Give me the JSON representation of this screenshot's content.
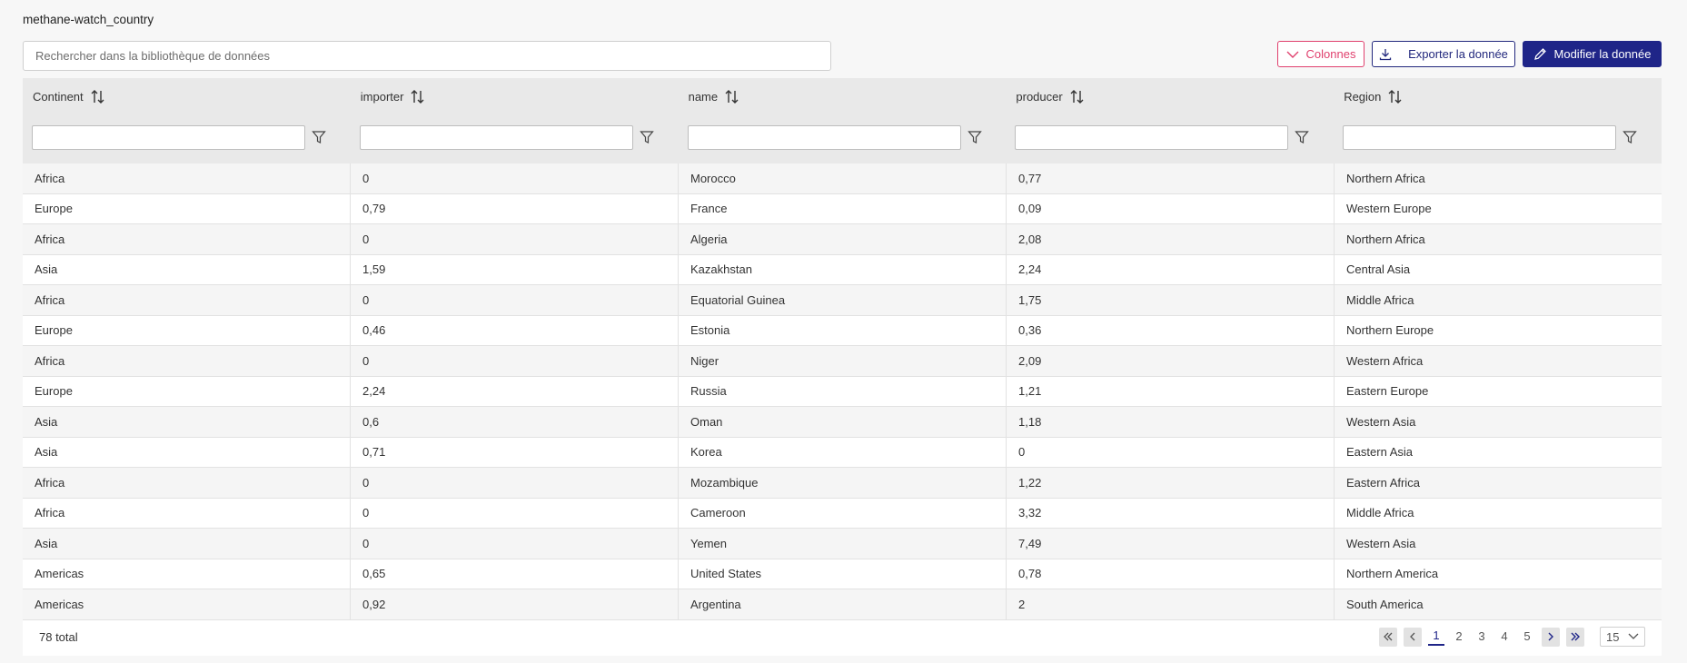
{
  "page": {
    "title": "methane-watch_country"
  },
  "search": {
    "placeholder": "Rechercher dans la bibliothèque de données"
  },
  "toolbar": {
    "columns_label": "Colonnes",
    "export_label": "Exporter la donnée",
    "edit_label": "Modifier la donnée"
  },
  "table": {
    "columns": [
      "Continent",
      "importer",
      "name",
      "producer",
      "Region"
    ],
    "rows": [
      [
        "Africa",
        "0",
        "Morocco",
        "0,77",
        "Northern Africa"
      ],
      [
        "Europe",
        "0,79",
        "France",
        "0,09",
        "Western Europe"
      ],
      [
        "Africa",
        "0",
        "Algeria",
        "2,08",
        "Northern Africa"
      ],
      [
        "Asia",
        "1,59",
        "Kazakhstan",
        "2,24",
        "Central Asia"
      ],
      [
        "Africa",
        "0",
        "Equatorial Guinea",
        "1,75",
        "Middle Africa"
      ],
      [
        "Europe",
        "0,46",
        "Estonia",
        "0,36",
        "Northern Europe"
      ],
      [
        "Africa",
        "0",
        "Niger",
        "2,09",
        "Western Africa"
      ],
      [
        "Europe",
        "2,24",
        "Russia",
        "1,21",
        "Eastern Europe"
      ],
      [
        "Asia",
        "0,6",
        "Oman",
        "1,18",
        "Western Asia"
      ],
      [
        "Asia",
        "0,71",
        "Korea",
        "0",
        "Eastern Asia"
      ],
      [
        "Africa",
        "0",
        "Mozambique",
        "1,22",
        "Eastern Africa"
      ],
      [
        "Africa",
        "0",
        "Cameroon",
        "3,32",
        "Middle Africa"
      ],
      [
        "Asia",
        "0",
        "Yemen",
        "7,49",
        "Western Asia"
      ],
      [
        "Americas",
        "0,65",
        "United States",
        "0,78",
        "Northern America"
      ],
      [
        "Americas",
        "0,92",
        "Argentina",
        "2",
        "South America"
      ]
    ]
  },
  "footer": {
    "total_label": "78 total",
    "pages": [
      "1",
      "2",
      "3",
      "4",
      "5"
    ],
    "current_page": "1",
    "page_size": "15"
  },
  "colors": {
    "primary": "#1f2588",
    "columns_button": "#e0416e",
    "header_bg": "#e9e9e9"
  },
  "icons": {
    "columns_button": "chevron-down-icon",
    "export_button": "download-icon",
    "edit_button": "pencil-icon",
    "column_sort": "sort-arrows-icon",
    "column_filter": "funnel-icon"
  }
}
